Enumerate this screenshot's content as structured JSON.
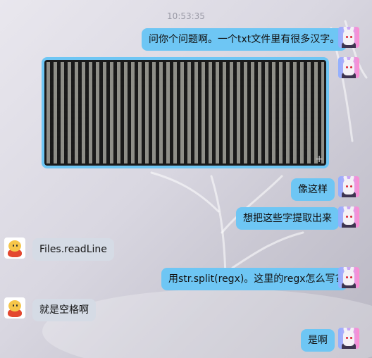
{
  "chat": {
    "timestamp": "10:53:35",
    "messages": [
      {
        "sender": "me",
        "type": "text",
        "text": "问你个问题啊。一个txt文件里有很多汉字。"
      },
      {
        "sender": "me",
        "type": "image",
        "icon": "text-screenshot",
        "expand_icon": "+"
      },
      {
        "sender": "me",
        "type": "text",
        "text": "像这样"
      },
      {
        "sender": "me",
        "type": "text",
        "text": "想把这些字提取出来"
      },
      {
        "sender": "other",
        "type": "text",
        "text": "Files.readLine"
      },
      {
        "sender": "me",
        "type": "text",
        "text": "用str.split(regx)。这里的regx怎么写?"
      },
      {
        "sender": "other",
        "type": "text",
        "text": "就是空格啊"
      },
      {
        "sender": "me",
        "type": "text",
        "text": "是啊"
      }
    ]
  },
  "colors": {
    "my_bubble": "#6ec6f4",
    "other_bubble": "#d5dbe5"
  }
}
